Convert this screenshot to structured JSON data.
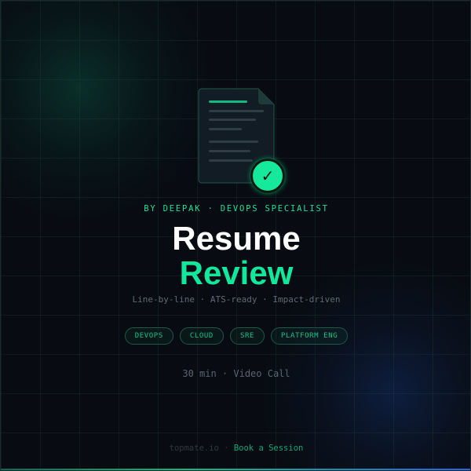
{
  "byline": "BY DEEPAK · DEVOPS SPECIALIST",
  "title": {
    "line1": "Resume",
    "line2": "Review"
  },
  "subtitle": "Line-by-line · ATS-ready · Impact-driven",
  "tags": [
    "DEVOPS",
    "CLOUD",
    "SRE",
    "PLATFORM ENG"
  ],
  "meta": "30 min · Video Call",
  "footer": {
    "site": "topmate.io",
    "separator": "·",
    "cta": "Book a Session"
  },
  "badge": {
    "icon": "checkmark-icon",
    "glyph": "✓"
  },
  "colors": {
    "background": "#080c12",
    "accent": "#12e89c",
    "tag_text": "#17c487",
    "muted": "#5f6a75"
  }
}
